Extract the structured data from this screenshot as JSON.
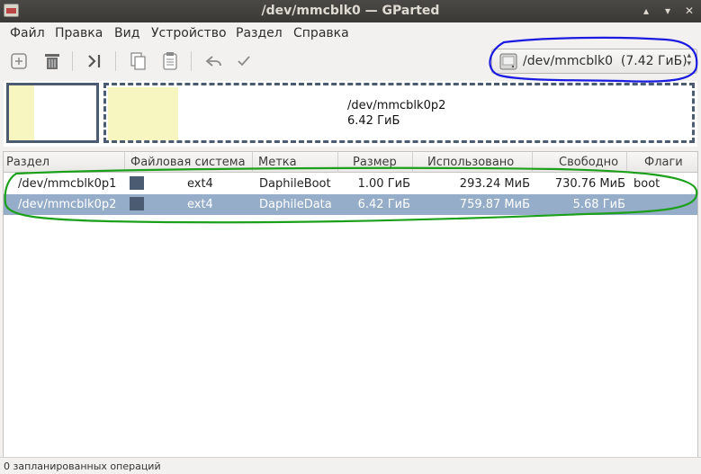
{
  "window": {
    "title": "/dev/mmcblk0 — GParted",
    "controls": [
      "▴",
      "▾",
      "✕"
    ]
  },
  "menu": [
    "Файл",
    "Правка",
    "Вид",
    "Устройство",
    "Раздел",
    "Справка"
  ],
  "toolbar": {
    "buttons": [
      "new-partition",
      "delete-partition",
      "resize-move",
      "copy",
      "paste",
      "undo",
      "apply"
    ]
  },
  "device": {
    "name": "/dev/mmcblk0",
    "size": "(7.42 ГиБ)"
  },
  "partition_map": {
    "selected_name": "/dev/mmcblk0p2",
    "selected_size": "6.42 ГиБ",
    "p1_used_fraction": 0.29,
    "p2_used_fraction": 0.12
  },
  "table": {
    "columns": [
      "Раздел",
      "Файловая система",
      "Метка",
      "Размер",
      "Использовано",
      "Свободно",
      "Флаги"
    ],
    "rows": [
      {
        "partition": "/dev/mmcblk0p1",
        "fs": "ext4",
        "label": "DaphileBoot",
        "size": "1.00 ГиБ",
        "used": "293.24 МиБ",
        "free": "730.76 МиБ",
        "flags": "boot",
        "selected": false
      },
      {
        "partition": "/dev/mmcblk0p2",
        "fs": "ext4",
        "label": "DaphileData",
        "size": "6.42 ГиБ",
        "used": "759.87 МиБ",
        "free": "5.68 ГиБ",
        "flags": "",
        "selected": true
      }
    ]
  },
  "status": "0 запланированных операций",
  "colors": {
    "selection": "#95adc9",
    "ext4": "#4a5b72",
    "used_space": "#f7f6c1",
    "annotation_blue": "#1a1ae0",
    "annotation_green": "#1ca01c"
  }
}
